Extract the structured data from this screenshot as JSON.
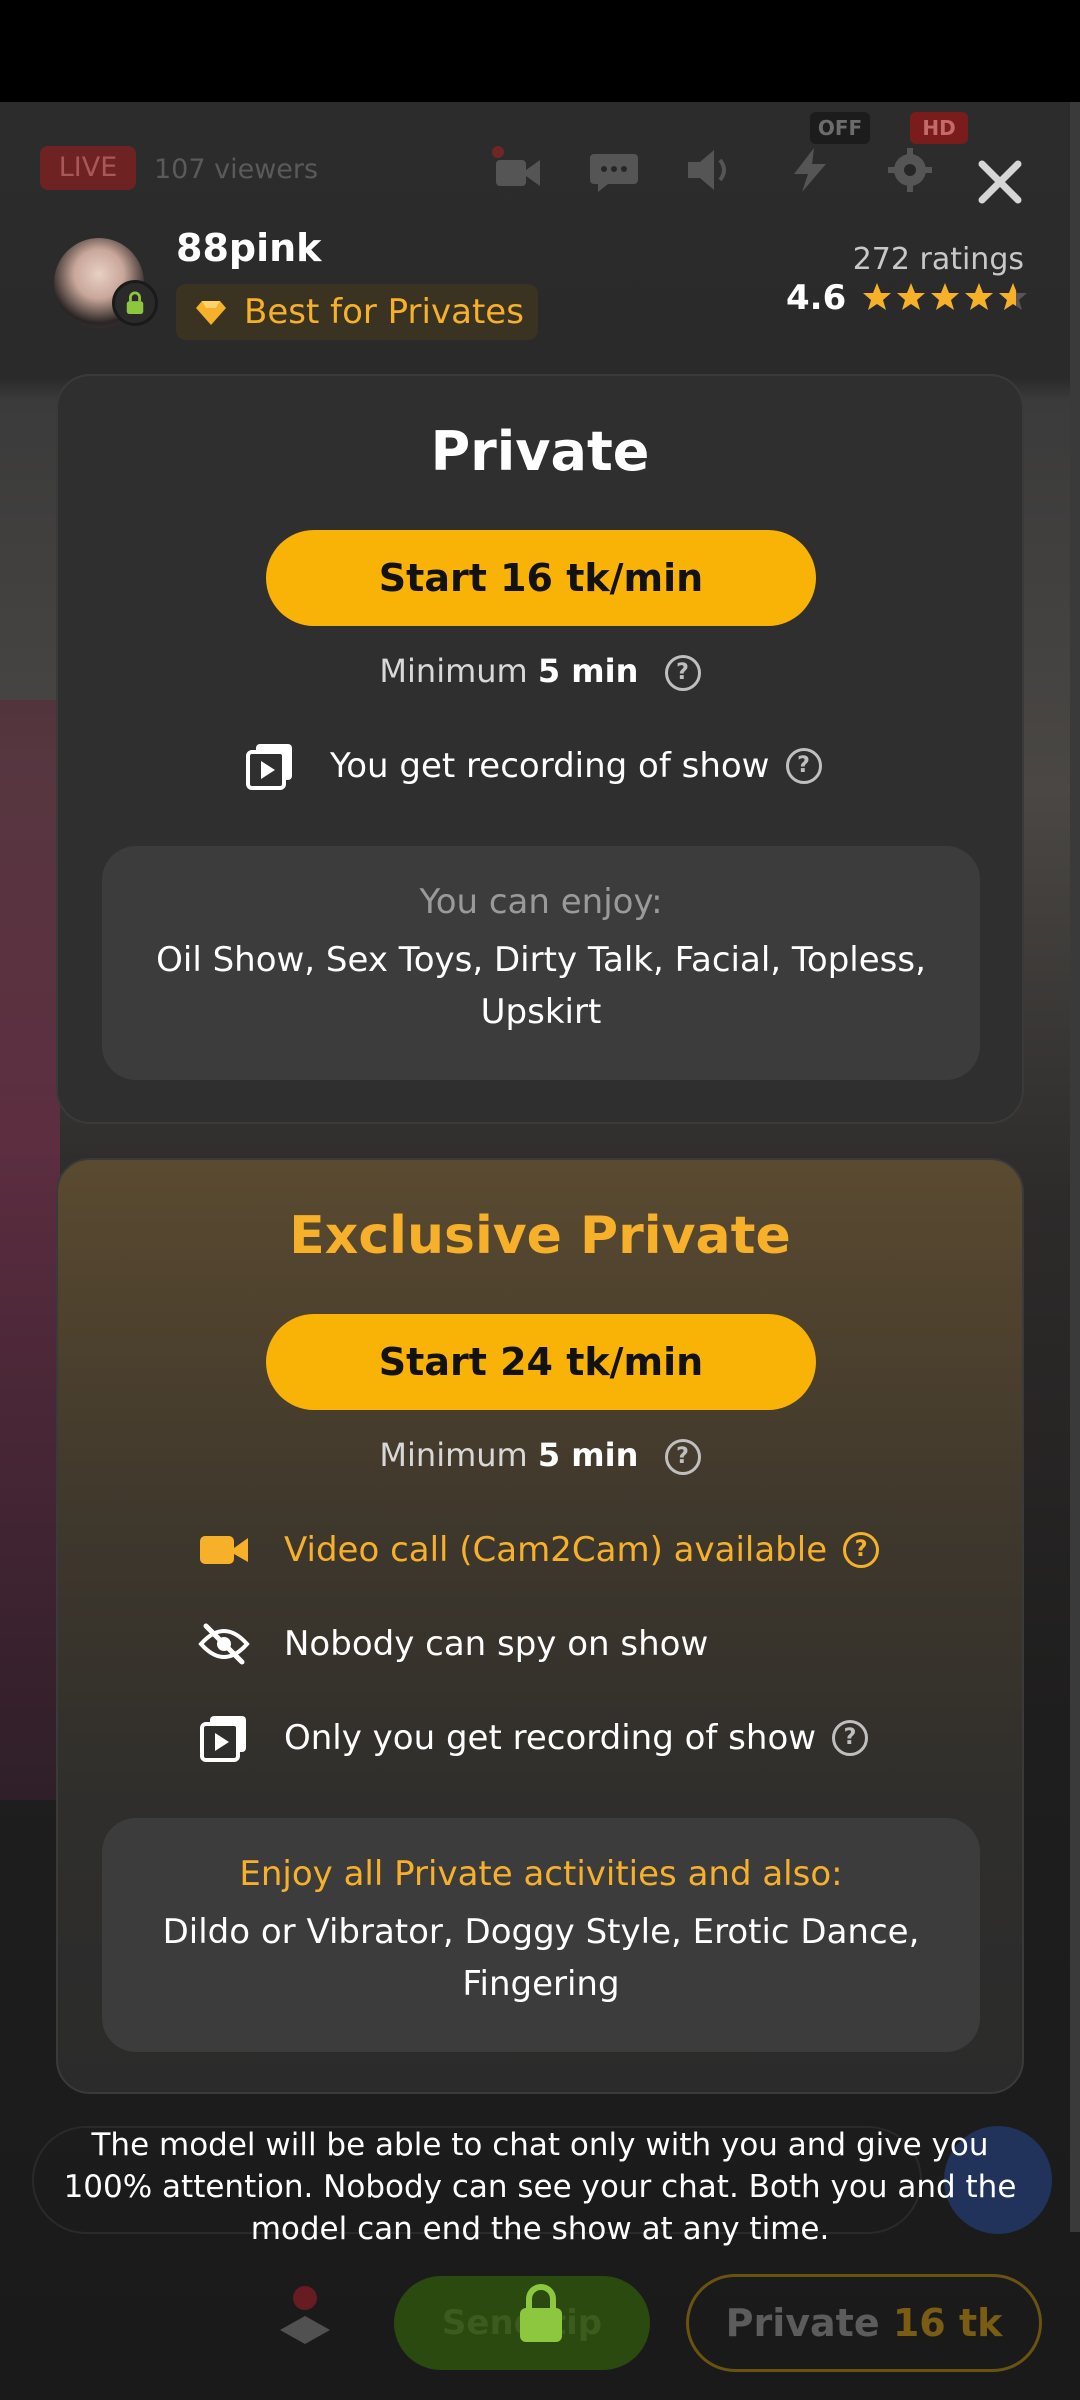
{
  "toolbar": {
    "live_label": "LIVE",
    "viewers": "107 viewers",
    "off_badge": "OFF",
    "hd_badge": "HD"
  },
  "profile": {
    "username": "88pink",
    "badge": "Best for Privates",
    "ratings_count": "272 ratings",
    "rating_value": "4.6",
    "rating_stars": 4.6
  },
  "private": {
    "title": "Private",
    "start_label": "Start 16 tk/min",
    "minimum_prefix": "Minimum",
    "minimum_value": "5 min",
    "feature_recording": "You get recording of show",
    "enjoy_title": "You can enjoy:",
    "enjoy_list": "Oil Show, Sex Toys, Dirty Talk, Facial, Topless, Upskirt"
  },
  "exclusive": {
    "title": "Exclusive Private",
    "start_label": "Start 24 tk/min",
    "minimum_prefix": "Minimum",
    "minimum_value": "5 min",
    "feature_cam2cam": "Video call (Cam2Cam) available",
    "feature_nospy": "Nobody can spy on show",
    "feature_recording": "Only you get recording of show",
    "enjoy_title": "Enjoy all Private activities and also:",
    "enjoy_list": "Dildo or Vibrator, Doggy Style, Erotic Dance, Fingering"
  },
  "footer": {
    "text": "The model will be able to chat only with you and give you 100% attention. Nobody can see your chat. Both you and the model can end the show at any time."
  },
  "bottom_bar": {
    "send_tip_label": "Send tip",
    "private_label": "Private",
    "private_price": "16 tk"
  },
  "colors": {
    "accent": "#f9b206",
    "gold_text": "#f6b02a",
    "card_bg": "#2f2f2f"
  }
}
